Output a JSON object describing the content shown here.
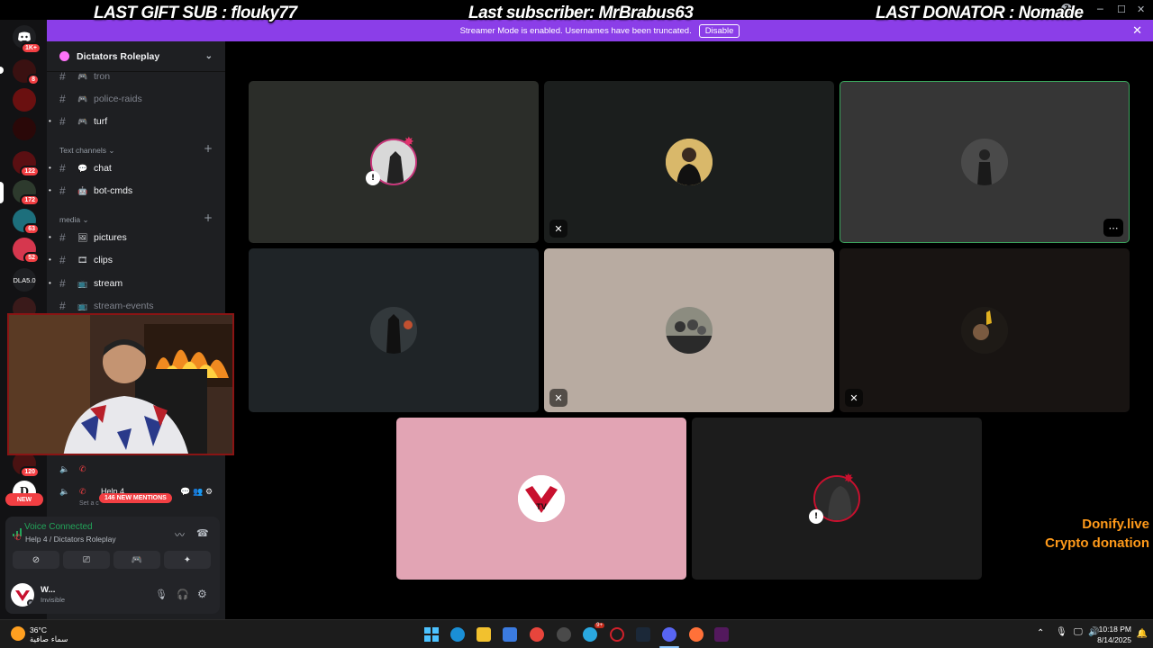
{
  "overlay": {
    "last_gift_sub": "LAST GIFT SUB : flouky77",
    "last_subscriber": "Last subscriber: MrBrabus63",
    "last_donator": "LAST DONATOR : Nomade",
    "donify_line1": "Donify.live",
    "donify_line2": "Crypto donation"
  },
  "banner": {
    "message": "Streamer Mode is enabled. Usernames have been truncated.",
    "button": "Disable"
  },
  "server_rail": {
    "top_badge": "1K+",
    "badges": [
      "8",
      "122",
      "172",
      "63",
      "52",
      "120"
    ],
    "text_server": "DLA5.0",
    "new_pill": "NEW"
  },
  "sidebar": {
    "server_name": "Dictators Roleplay",
    "channels_top": [
      {
        "name": "tron",
        "muted": true
      },
      {
        "name": "police-raids",
        "muted": true
      },
      {
        "name": "turf",
        "muted": false
      }
    ],
    "category_text": "Text channels",
    "text_channels": [
      {
        "name": "chat",
        "muted": false
      },
      {
        "name": "bot-cmds",
        "muted": false
      }
    ],
    "category_media": "media",
    "media_channels": [
      {
        "name": "pictures",
        "muted": false
      },
      {
        "name": "clips",
        "muted": false
      },
      {
        "name": "stream",
        "muted": false
      },
      {
        "name": "stream-events",
        "muted": true
      }
    ],
    "voice_channel_name": "Help 4",
    "voice_channel_sub": "Set a c",
    "mentions_pill": "146 NEW MENTIONS"
  },
  "voice_panel": {
    "status": "Voice Connected",
    "location": "Help 4 / Dictators Roleplay",
    "user_name": "W...",
    "user_status": "Invisible"
  },
  "taskbar": {
    "temperature": "36°C",
    "weather": "سماء صافية",
    "time": "10:18 PM",
    "date": "8/14/2025",
    "steam_badge": "9+"
  },
  "colors": {
    "accent_purple": "#8b3ee8",
    "voice_green": "#23a55a",
    "badge_red": "#f23f43"
  }
}
